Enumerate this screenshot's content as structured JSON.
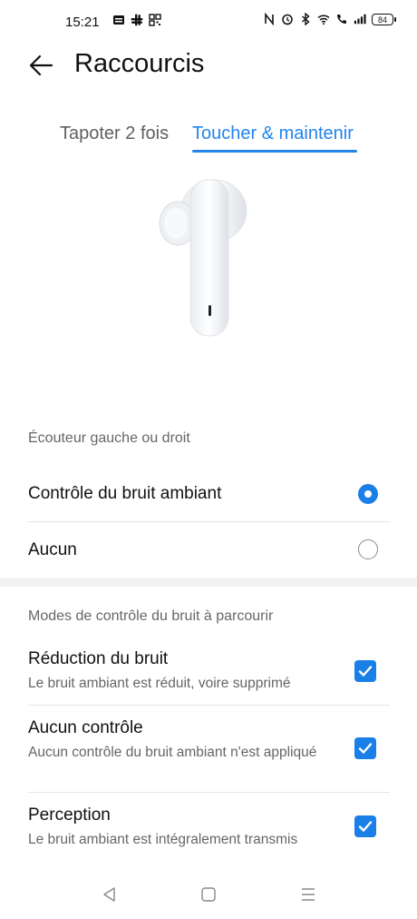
{
  "status_bar": {
    "time": "15:21",
    "battery": "84",
    "left_icons": [
      "notification-icon",
      "slack-icon",
      "qr-icon"
    ],
    "right_icons": [
      "nfc-icon",
      "alarm-icon",
      "bluetooth-icon",
      "wifi-icon",
      "call-icon",
      "signal-icon"
    ]
  },
  "header": {
    "back_icon": "arrow-left-icon",
    "title": "Raccourcis"
  },
  "tabs": [
    {
      "label": "Tapoter 2 fois",
      "active": false
    },
    {
      "label": "Toucher & maintenir",
      "active": true
    }
  ],
  "accent_color": "#2384ec",
  "section1": {
    "label": "Écouteur gauche ou droit",
    "options": [
      {
        "label": "Contrôle du bruit ambiant",
        "selected": true
      },
      {
        "label": "Aucun",
        "selected": false
      }
    ]
  },
  "section2": {
    "label": "Modes de contrôle du bruit à parcourir",
    "items": [
      {
        "title": "Réduction du bruit",
        "subtitle": "Le bruit ambiant est réduit, voire supprimé",
        "checked": true
      },
      {
        "title": "Aucun contrôle",
        "subtitle": "Aucun contrôle du bruit ambiant n'est appliqué",
        "checked": true
      },
      {
        "title": "Perception",
        "subtitle": "Le bruit ambiant est intégralement transmis",
        "checked": true
      }
    ]
  },
  "nav_bar": {
    "icons": [
      "back-triangle-icon",
      "home-square-icon",
      "menu-lines-icon"
    ]
  }
}
